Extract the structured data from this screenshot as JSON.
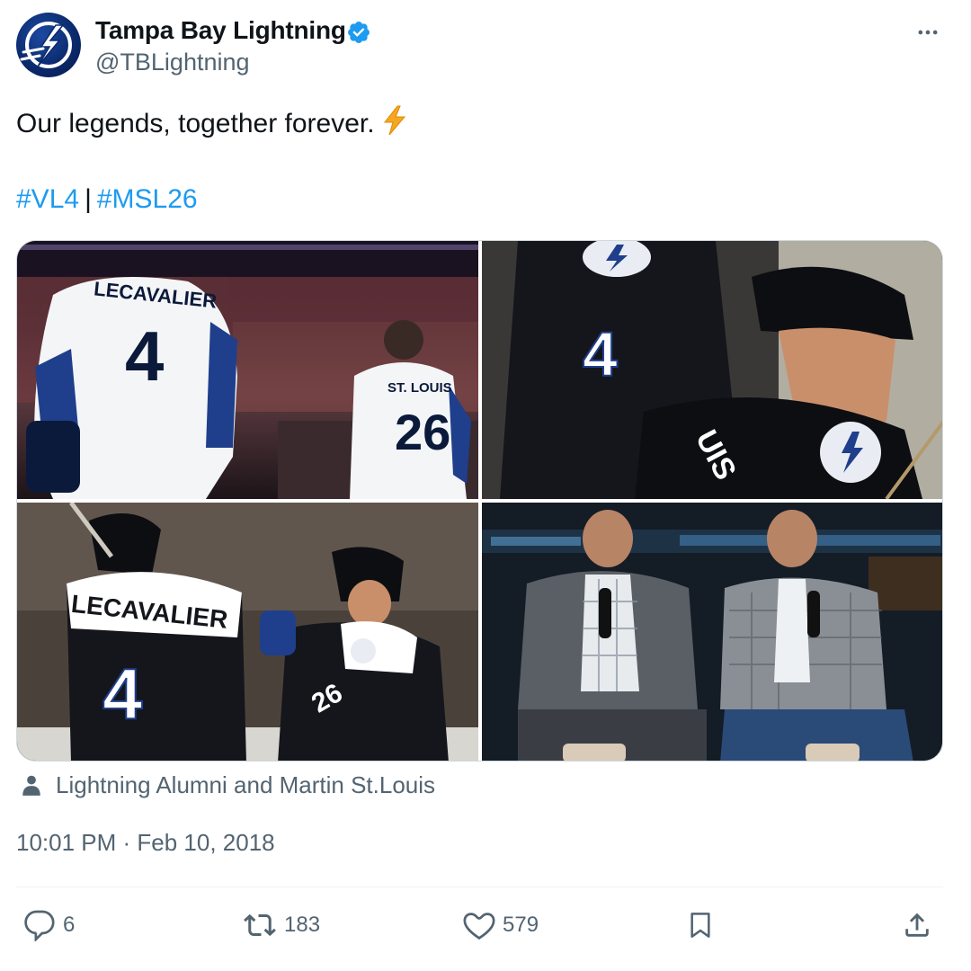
{
  "author": {
    "display_name": "Tampa Bay Lightning",
    "handle": "@TBLightning",
    "verified": true,
    "avatar_icon": "lightning-bolt-logo-icon"
  },
  "tweet": {
    "text": "Our legends, together forever.",
    "emoji": "⚡",
    "hashtags": [
      "#VL4",
      "#MSL26"
    ],
    "hashtag_separator": "|"
  },
  "media": {
    "photos": [
      {
        "label": "LECAVALIER 4 and ST. LOUIS 26 in white jerseys"
      },
      {
        "label": "Helmeted player close-up, jersey number 4"
      },
      {
        "label": "LECAVALIER 4 and number 26 in dark jerseys"
      },
      {
        "label": "Two men seated on stage with microphones"
      }
    ]
  },
  "tagged": {
    "icon": "person-icon",
    "text": "Lightning Alumni and Martin St.Louis"
  },
  "timestamp": "10:01 PM · Feb 10, 2018",
  "actions": {
    "reply_count": "6",
    "retweet_count": "183",
    "like_count": "579"
  },
  "colors": {
    "accent": "#1d9bf0",
    "secondary_text": "#536471",
    "primary_text": "#0f1419"
  }
}
